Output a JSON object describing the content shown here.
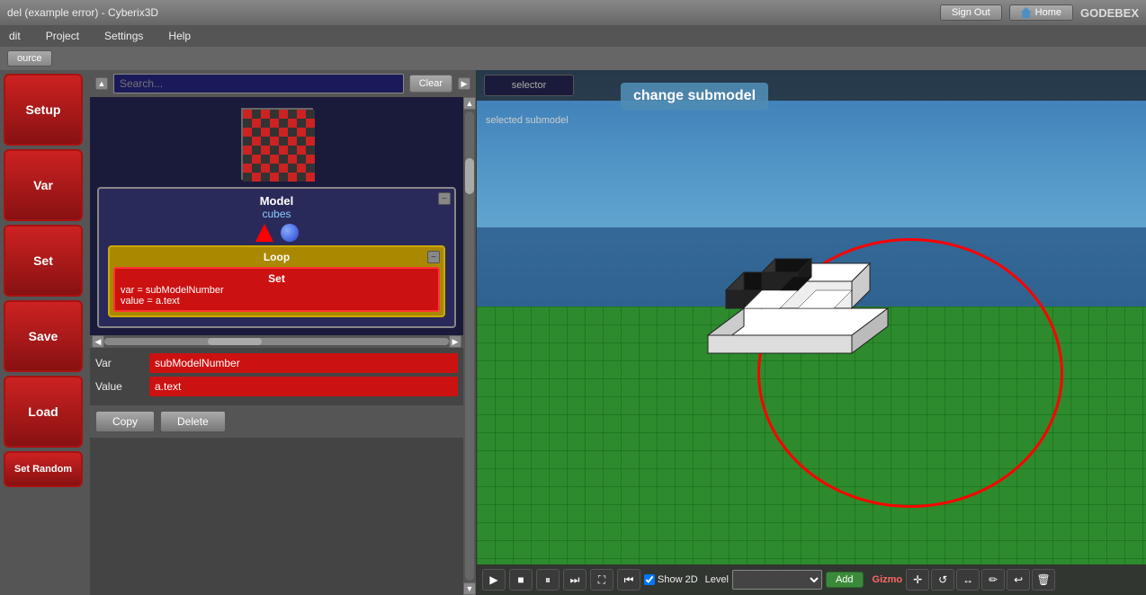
{
  "titleBar": {
    "title": "del (example error) - Cyberix3D",
    "signOutLabel": "Sign Out",
    "homeLabel": "Home",
    "userLabel": "GODEBEX"
  },
  "menuBar": {
    "items": [
      "dit",
      "Project",
      "Settings",
      "Help"
    ]
  },
  "sourceBar": {
    "sourceLabel": "ource"
  },
  "sidebar": {
    "buttons": [
      "Setup",
      "Var",
      "Set",
      "Save",
      "Load",
      "Set Random"
    ]
  },
  "searchBar": {
    "placeholder": "Search...",
    "clearLabel": "Clear"
  },
  "scriptPanel": {
    "modelTitle": "Model",
    "modelName": "cubes",
    "loopTitle": "Loop",
    "setTitle": "Set",
    "setLine1": "var = subModelNumber",
    "setLine2": "value = a.text"
  },
  "varValuePanel": {
    "varLabel": "Var",
    "varValue": "subModelNumber",
    "valueLabel": "Value",
    "valueValue": "a.text"
  },
  "bottomButtons": {
    "copyLabel": "Copy",
    "deleteLabel": "Delete"
  },
  "viewport": {
    "tooltipText": "change submodel",
    "submodelText": "selected submodel"
  },
  "bottomToolbar": {
    "show2DLabel": "Show 2D",
    "levelLabel": "Level",
    "addLabel": "Add",
    "gizmoLabel": "Gizmo"
  }
}
